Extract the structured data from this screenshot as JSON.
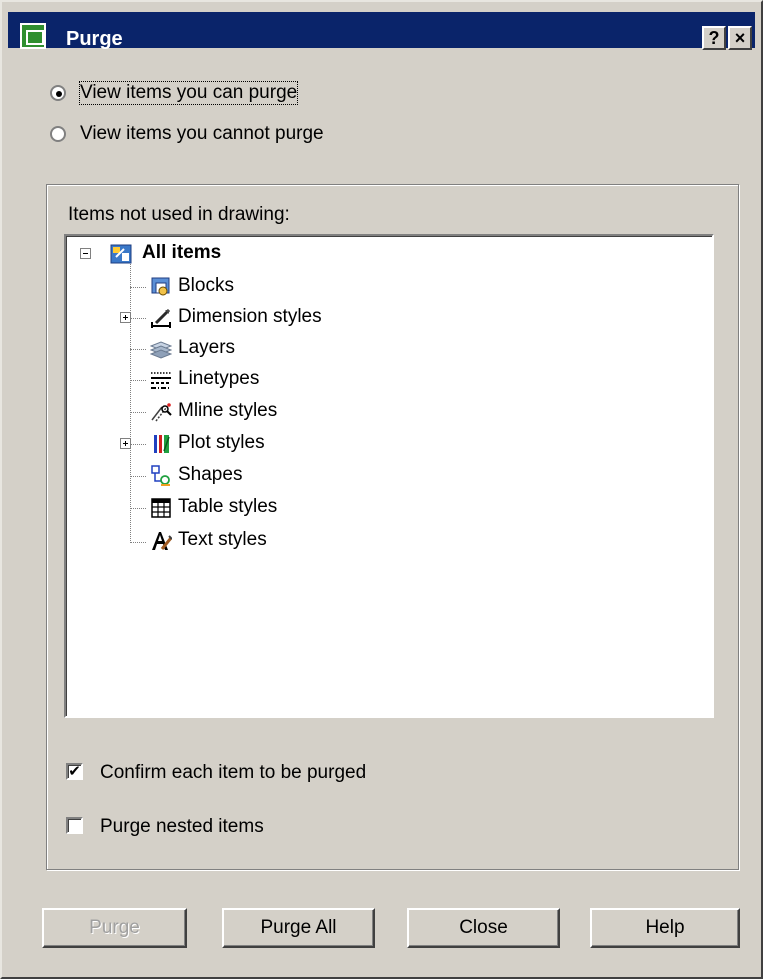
{
  "window": {
    "title": "Purge",
    "help_button": "?",
    "close_button": "×"
  },
  "options": {
    "view_can_purge": "View items you can purge",
    "view_cannot_purge": "View items you cannot purge",
    "selected": "view_can_purge"
  },
  "tree_group": {
    "caption": "Items not used in drawing:",
    "root_label": "All items",
    "items": [
      {
        "label": "Blocks",
        "icon": "blocks-icon",
        "expandable": false
      },
      {
        "label": "Dimension styles",
        "icon": "dimension-styles-icon",
        "expandable": true
      },
      {
        "label": "Layers",
        "icon": "layers-icon",
        "expandable": false
      },
      {
        "label": "Linetypes",
        "icon": "linetypes-icon",
        "expandable": false
      },
      {
        "label": "Mline styles",
        "icon": "mline-styles-icon",
        "expandable": false
      },
      {
        "label": "Plot styles",
        "icon": "plot-styles-icon",
        "expandable": true
      },
      {
        "label": "Shapes",
        "icon": "shapes-icon",
        "expandable": false
      },
      {
        "label": "Table styles",
        "icon": "table-styles-icon",
        "expandable": false
      },
      {
        "label": "Text styles",
        "icon": "text-styles-icon",
        "expandable": false
      }
    ]
  },
  "checkboxes": {
    "confirm_label": "Confirm each item to be purged",
    "confirm_checked": true,
    "nested_label": "Purge nested items",
    "nested_checked": false
  },
  "buttons": {
    "purge": "Purge",
    "purge_all": "Purge All",
    "close": "Close",
    "help": "Help"
  },
  "colors": {
    "title_bar": "#0a246a",
    "dialog_face": "#d4d0c8",
    "tree_background": "#ffffff",
    "disabled_text": "#a0a0a0"
  }
}
